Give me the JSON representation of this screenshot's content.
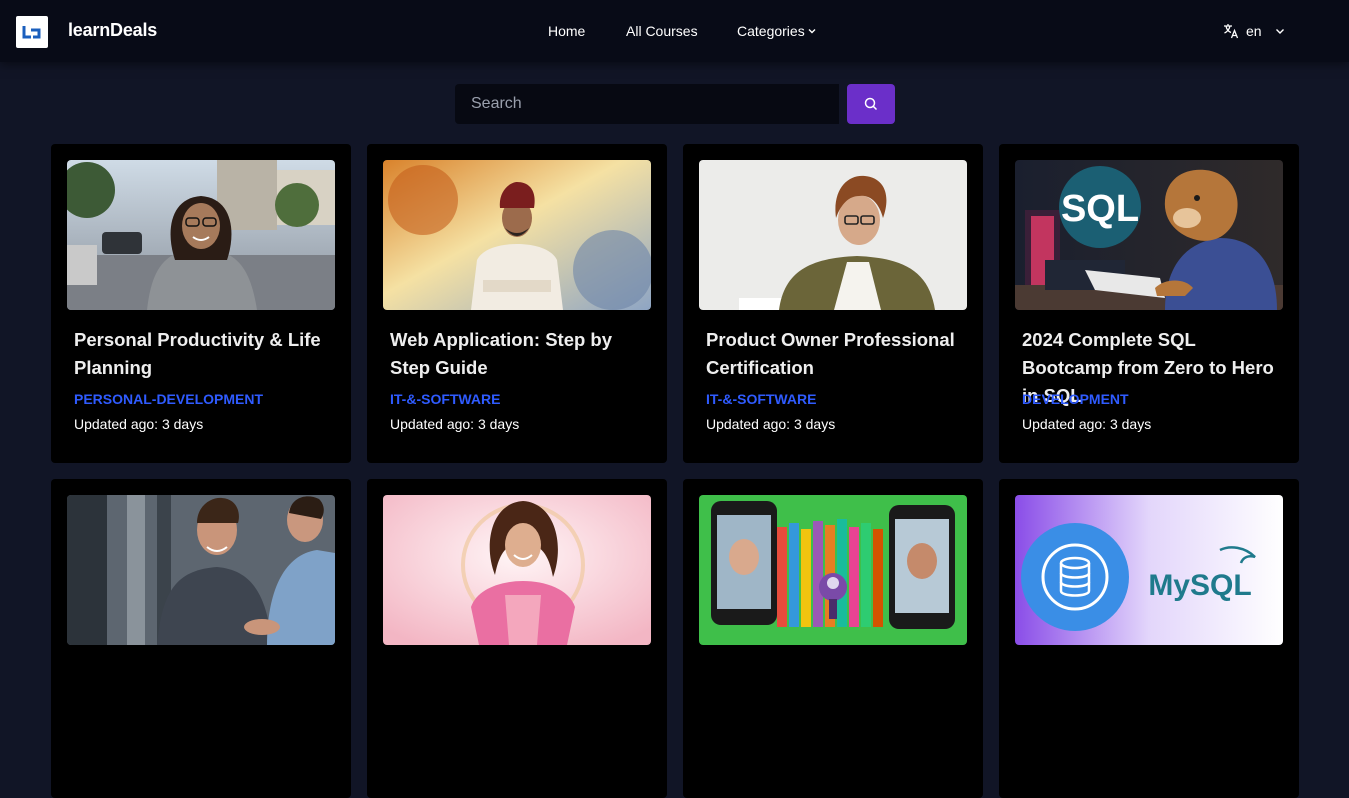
{
  "header": {
    "logo_text": "Lb",
    "brand": "learnDeals",
    "nav": {
      "home": "Home",
      "all_courses": "All Courses",
      "categories": "Categories"
    },
    "language": "en"
  },
  "search": {
    "placeholder": "Search"
  },
  "courses": [
    {
      "title": "Personal Productivity & Life Planning",
      "category": "PERSONAL-DEVELOPMENT",
      "updated": "Updated ago: 3 days"
    },
    {
      "title": "Web Application: Step by Step Guide",
      "category": "IT-&-SOFTWARE",
      "updated": "Updated ago: 3 days"
    },
    {
      "title": "Product Owner Professional Certification",
      "category": "IT-&-SOFTWARE",
      "updated": "Updated ago: 3 days"
    },
    {
      "title": "2024 Complete SQL Bootcamp from Zero to Hero in SQL",
      "category": "DEVELOPMENT",
      "updated": "Updated ago: 3 days",
      "image_text": "SQL"
    },
    {
      "title": "",
      "category": "",
      "updated": ""
    },
    {
      "title": "",
      "category": "",
      "updated": ""
    },
    {
      "title": "",
      "category": "",
      "updated": ""
    },
    {
      "title": "",
      "category": "",
      "updated": "",
      "image_text": "MySQL"
    }
  ],
  "colors": {
    "page_bg": "#111526",
    "header_bg": "#080b17",
    "card_bg": "#000000",
    "accent": "#6b2fc9",
    "category_blue": "#2f5bff"
  }
}
